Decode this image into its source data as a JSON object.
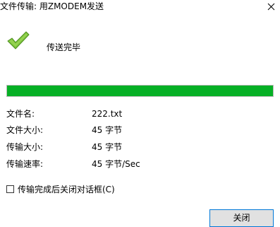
{
  "window": {
    "title": "文件传输: 用ZMODEM发送",
    "close_icon": "close-x-icon"
  },
  "status": {
    "icon": "green-checkmark-icon",
    "text": "传送完毕"
  },
  "progress": {
    "fraction": 1.0,
    "color": "#06b025"
  },
  "info": {
    "file_name_label": "文件名:",
    "file_name_value": "222.txt",
    "file_size_label": "文件大小:",
    "file_size_value": "45 字节",
    "transfer_size_label": "传输大小:",
    "transfer_size_value": "45 字节",
    "transfer_rate_label": "传输速率:",
    "transfer_rate_value": "45 字节/Sec"
  },
  "auto_close": {
    "label": "传输完成后关闭对话框(C)",
    "checked": false
  },
  "buttons": {
    "close_label": "关闭"
  },
  "colors": {
    "button_border": "#0078d7",
    "button_bg": "#e1e1e1"
  }
}
